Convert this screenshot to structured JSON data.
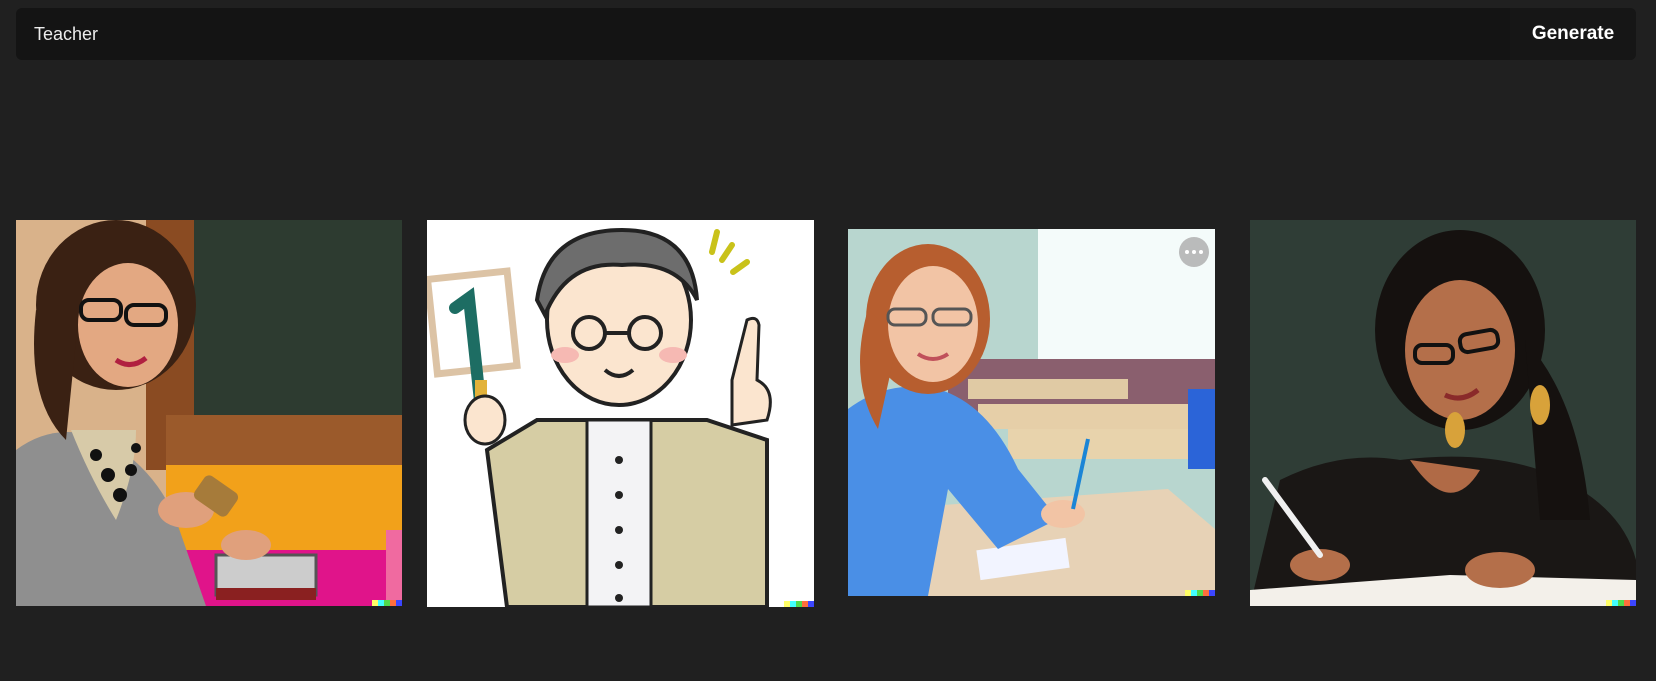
{
  "prompt": {
    "value": "Teacher",
    "generate_label": "Generate"
  },
  "results": {
    "count": 4,
    "more_icon": "more-horizontal-icon",
    "signature_colors": [
      "#ffff66",
      "#42ffff",
      "#51da4c",
      "#ff6e3c",
      "#3c46ff"
    ]
  },
  "colors": {
    "page_background": "#202020",
    "bar_background": "#141414",
    "text": "#ececec"
  }
}
